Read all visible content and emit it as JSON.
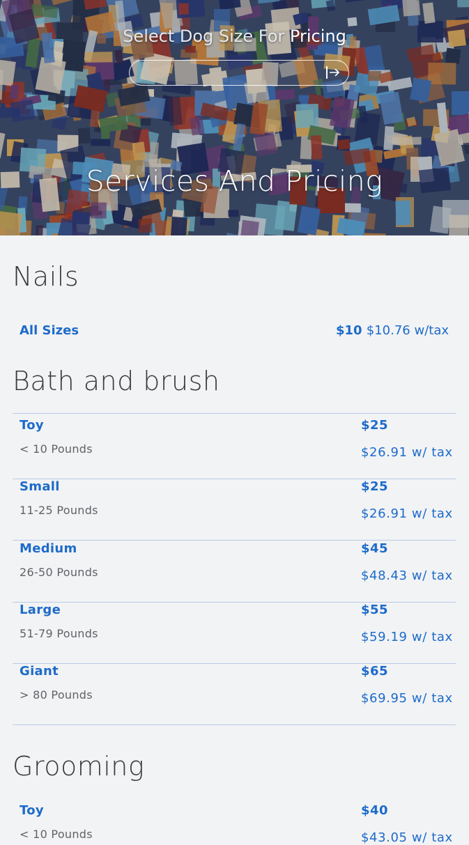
{
  "hero": {
    "select_title_lead": "Select Dog Size For ",
    "select_title_strong": "Pricing",
    "select_value": "",
    "page_title": "Services And Pricing"
  },
  "sections": {
    "nails": {
      "title": "Nails",
      "row": {
        "name": "All Sizes",
        "price": "$10",
        "tax": "$10.76 w/tax"
      }
    },
    "bath": {
      "title": "Bath and brush",
      "rows": [
        {
          "name": "Toy",
          "weight": "< 10 Pounds",
          "price": "$25",
          "tax": "$26.91 w/ tax"
        },
        {
          "name": "Small",
          "weight": "11-25 Pounds",
          "price": "$25",
          "tax": "$26.91 w/ tax"
        },
        {
          "name": "Medium",
          "weight": "26-50 Pounds",
          "price": "$45",
          "tax": "$48.43 w/ tax"
        },
        {
          "name": "Large",
          "weight": "51-79 Pounds",
          "price": "$55",
          "tax": "$59.19 w/ tax"
        },
        {
          "name": "Giant",
          "weight": "> 80 Pounds",
          "price": "$65",
          "tax": "$69.95 w/ tax"
        }
      ]
    },
    "grooming": {
      "title": "Grooming",
      "rows": [
        {
          "name": "Toy",
          "weight": "< 10 Pounds",
          "price": "$40",
          "tax": "$43.05 w/ tax"
        }
      ]
    }
  },
  "colors": {
    "accent": "#1d6bc9",
    "divider": "#b9cce4",
    "background": "#f2f3f5"
  }
}
